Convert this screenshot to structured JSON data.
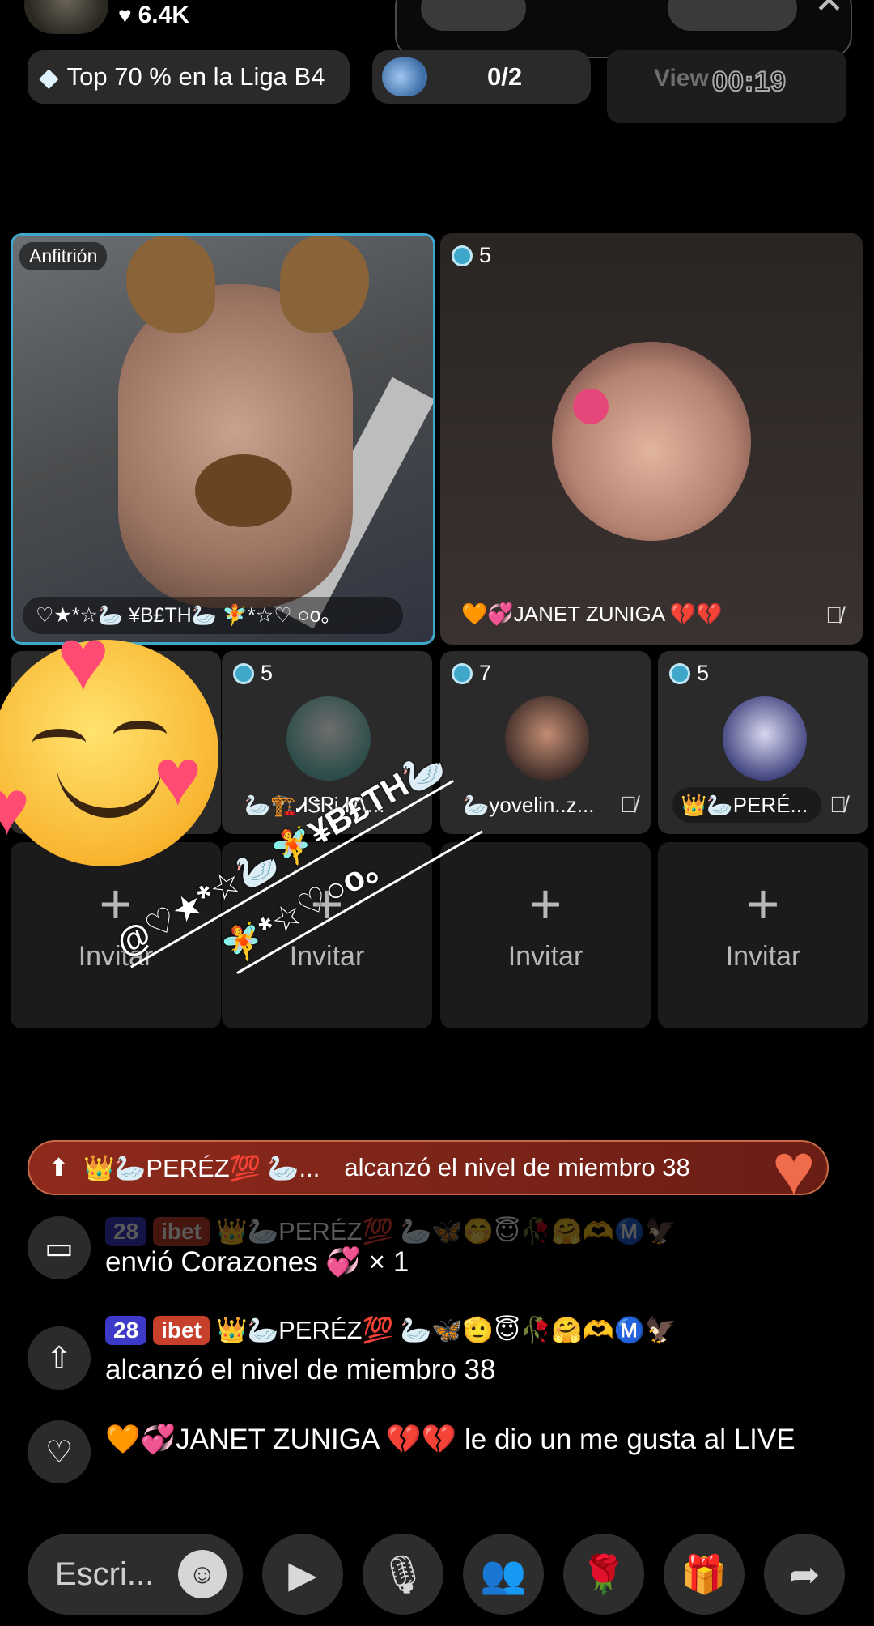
{
  "header": {
    "likes": "6.4K",
    "league_text": "Top 70 % en la Liga B4",
    "quest_count": "0/2",
    "viewers_label": "View",
    "timer": "00:19"
  },
  "host": {
    "badge": "Anfitrión",
    "name": "♡★*☆🦢 ¥B£TH🦢 🧚*☆♡ ○o。"
  },
  "guest_main": {
    "count": "5",
    "name": "🧡💞JANET ZUNIGA 💔💔"
  },
  "guests_small": [
    {
      "count": "5",
      "name": "🦢🏗️ᏗᏕᏒᎥᏗᏁ..."
    },
    {
      "count": "7",
      "name": "🦢yovelin..z..."
    },
    {
      "count": "5",
      "name": "👑🦢PERÉ..."
    }
  ],
  "invite_label": "Invitar",
  "tag_overlay": {
    "line1": "@♡★*☆🦢🧚¥B£TH🦢",
    "line2": "🧚*☆♡○o。"
  },
  "banner": {
    "user": "👑🦢PERÉZ💯 🦢...",
    "text": "alcanzó el nivel de miembro 38"
  },
  "chat": [
    {
      "badge_level": "28",
      "badge_fan": "ibet",
      "user": "👑🦢PERÉZ💯 🦢🦋🤭😇🥀🤗🫶Ⓜ️🦅",
      "text": "envió Corazones 💞 × 1"
    },
    {
      "badge_level": "28",
      "badge_fan": "ibet",
      "user": "👑🦢PERÉZ💯 🦢🦋🫡😇🥀🤗🫶Ⓜ️🦅",
      "text": "alcanzó el nivel de miembro 38"
    },
    {
      "text": "🧡💞JANET ZUNIGA 💔💔 le dio un me gusta al LIVE"
    }
  ],
  "bottom": {
    "comment_placeholder": "Escri..."
  },
  "colors": {
    "host_border": "#3fa7c9",
    "banner_bg": "#7a2318",
    "level_badge": "#3d39c9",
    "fan_badge": "#c6402b"
  }
}
